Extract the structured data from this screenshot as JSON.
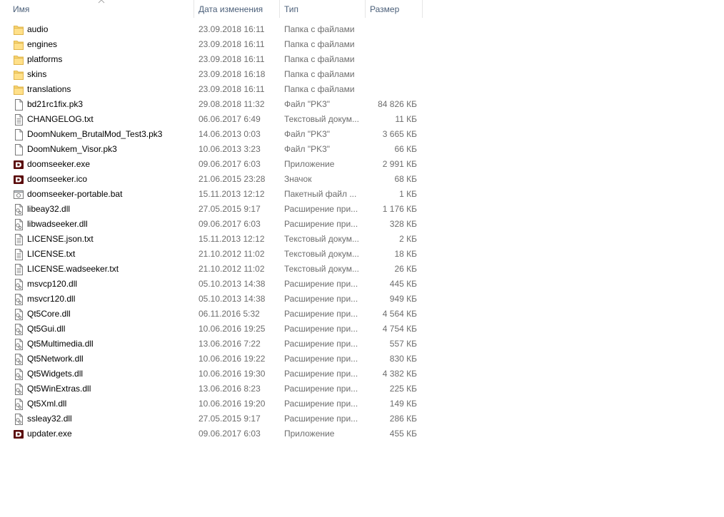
{
  "columns": {
    "name": "Имя",
    "date": "Дата изменения",
    "type": "Тип",
    "size": "Размер"
  },
  "files": [
    {
      "name": "audio",
      "date": "23.09.2018 16:11",
      "type": "Папка с файлами",
      "size": "",
      "icon": "folder-icon"
    },
    {
      "name": "engines",
      "date": "23.09.2018 16:11",
      "type": "Папка с файлами",
      "size": "",
      "icon": "folder-icon"
    },
    {
      "name": "platforms",
      "date": "23.09.2018 16:11",
      "type": "Папка с файлами",
      "size": "",
      "icon": "folder-icon"
    },
    {
      "name": "skins",
      "date": "23.09.2018 16:18",
      "type": "Папка с файлами",
      "size": "",
      "icon": "folder-icon"
    },
    {
      "name": "translations",
      "date": "23.09.2018 16:11",
      "type": "Папка с файлами",
      "size": "",
      "icon": "folder-icon"
    },
    {
      "name": "bd21rc1fix.pk3",
      "date": "29.08.2018 11:32",
      "type": "Файл \"PK3\"",
      "size": "84 826 КБ",
      "icon": "file-icon"
    },
    {
      "name": "CHANGELOG.txt",
      "date": "06.06.2017 6:49",
      "type": "Текстовый докум...",
      "size": "11 КБ",
      "icon": "text-file-icon"
    },
    {
      "name": "DoomNukem_BrutalMod_Test3.pk3",
      "date": "14.06.2013 0:03",
      "type": "Файл \"PK3\"",
      "size": "3 665 КБ",
      "icon": "file-icon"
    },
    {
      "name": "DoomNukem_Visor.pk3",
      "date": "10.06.2013 3:23",
      "type": "Файл \"PK3\"",
      "size": "66 КБ",
      "icon": "file-icon"
    },
    {
      "name": "doomseeker.exe",
      "date": "09.06.2017 6:03",
      "type": "Приложение",
      "size": "2 991 КБ",
      "icon": "doomseeker-icon"
    },
    {
      "name": "doomseeker.ico",
      "date": "21.06.2015 23:28",
      "type": "Значок",
      "size": "68 КБ",
      "icon": "doomseeker-icon"
    },
    {
      "name": "doomseeker-portable.bat",
      "date": "15.11.2013 12:12",
      "type": "Пакетный файл ...",
      "size": "1 КБ",
      "icon": "batch-file-icon"
    },
    {
      "name": "libeay32.dll",
      "date": "27.05.2015 9:17",
      "type": "Расширение при...",
      "size": "1 176 КБ",
      "icon": "dll-file-icon"
    },
    {
      "name": "libwadseeker.dll",
      "date": "09.06.2017 6:03",
      "type": "Расширение при...",
      "size": "328 КБ",
      "icon": "dll-file-icon"
    },
    {
      "name": "LICENSE.json.txt",
      "date": "15.11.2013 12:12",
      "type": "Текстовый докум...",
      "size": "2 КБ",
      "icon": "text-file-icon"
    },
    {
      "name": "LICENSE.txt",
      "date": "21.10.2012 11:02",
      "type": "Текстовый докум...",
      "size": "18 КБ",
      "icon": "text-file-icon"
    },
    {
      "name": "LICENSE.wadseeker.txt",
      "date": "21.10.2012 11:02",
      "type": "Текстовый докум...",
      "size": "26 КБ",
      "icon": "text-file-icon"
    },
    {
      "name": "msvcp120.dll",
      "date": "05.10.2013 14:38",
      "type": "Расширение при...",
      "size": "445 КБ",
      "icon": "dll-file-icon"
    },
    {
      "name": "msvcr120.dll",
      "date": "05.10.2013 14:38",
      "type": "Расширение при...",
      "size": "949 КБ",
      "icon": "dll-file-icon"
    },
    {
      "name": "Qt5Core.dll",
      "date": "06.11.2016 5:32",
      "type": "Расширение при...",
      "size": "4 564 КБ",
      "icon": "dll-file-icon"
    },
    {
      "name": "Qt5Gui.dll",
      "date": "10.06.2016 19:25",
      "type": "Расширение при...",
      "size": "4 754 КБ",
      "icon": "dll-file-icon"
    },
    {
      "name": "Qt5Multimedia.dll",
      "date": "13.06.2016 7:22",
      "type": "Расширение при...",
      "size": "557 КБ",
      "icon": "dll-file-icon"
    },
    {
      "name": "Qt5Network.dll",
      "date": "10.06.2016 19:22",
      "type": "Расширение при...",
      "size": "830 КБ",
      "icon": "dll-file-icon"
    },
    {
      "name": "Qt5Widgets.dll",
      "date": "10.06.2016 19:30",
      "type": "Расширение при...",
      "size": "4 382 КБ",
      "icon": "dll-file-icon"
    },
    {
      "name": "Qt5WinExtras.dll",
      "date": "13.06.2016 8:23",
      "type": "Расширение при...",
      "size": "225 КБ",
      "icon": "dll-file-icon"
    },
    {
      "name": "Qt5Xml.dll",
      "date": "10.06.2016 19:20",
      "type": "Расширение при...",
      "size": "149 КБ",
      "icon": "dll-file-icon"
    },
    {
      "name": "ssleay32.dll",
      "date": "27.05.2015 9:17",
      "type": "Расширение при...",
      "size": "286 КБ",
      "icon": "dll-file-icon"
    },
    {
      "name": "updater.exe",
      "date": "09.06.2017 6:03",
      "type": "Приложение",
      "size": "455 КБ",
      "icon": "doomseeker-icon"
    }
  ]
}
